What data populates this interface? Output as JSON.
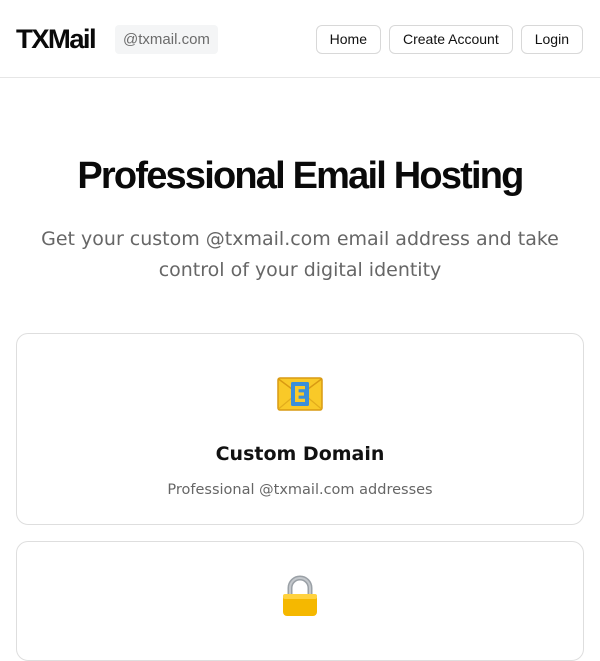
{
  "header": {
    "logo": "TXMail",
    "domain_badge": "@txmail.com",
    "nav": {
      "home": "Home",
      "create_account": "Create Account",
      "login": "Login"
    }
  },
  "hero": {
    "title": "Professional Email Hosting",
    "subtitle": "Get your custom @txmail.com email address and take control of your digital identity"
  },
  "features": [
    {
      "icon": "e-mail-envelope-icon",
      "title": "Custom Domain",
      "description": "Professional @txmail.com addresses"
    },
    {
      "icon": "padlock-icon",
      "title": "",
      "description": ""
    }
  ],
  "colors": {
    "text": "#111111",
    "muted_text": "#666666",
    "border": "#dedede",
    "badge_bg": "#f4f5f6",
    "envelope_yellow": "#f9c928",
    "envelope_letter_blue": "#3a8fd9",
    "padlock_gold": "#f5b800",
    "padlock_shackle": "#9aa0a6"
  }
}
